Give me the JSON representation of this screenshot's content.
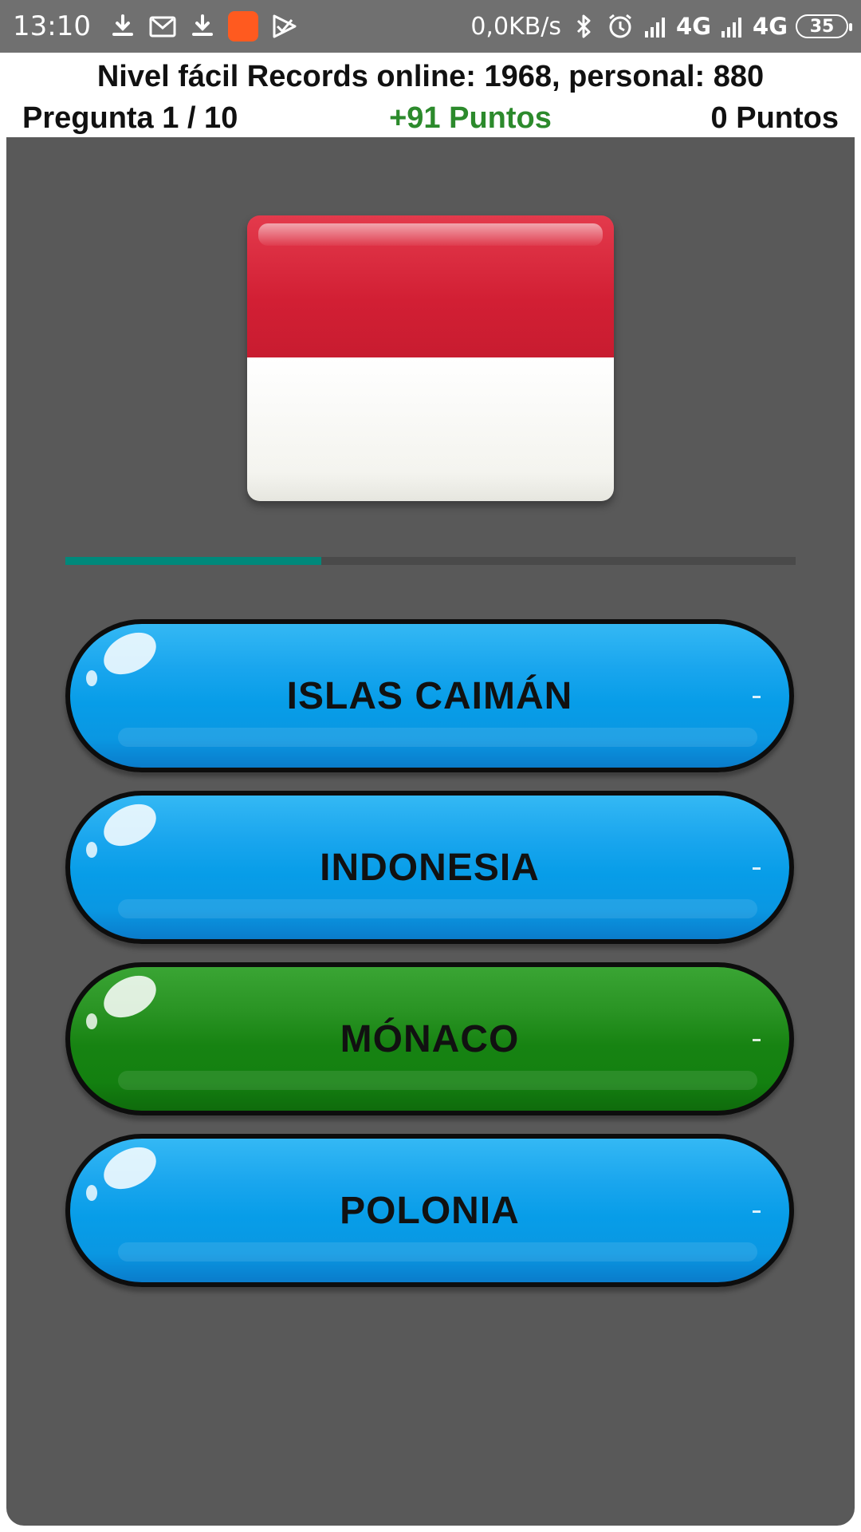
{
  "status_bar": {
    "time": "13:10",
    "left_icons": [
      "download-icon",
      "gmail-icon",
      "download-icon",
      "app-icon",
      "play-store-icon"
    ],
    "net_speed": "0,0KB/s",
    "right_icons": [
      "bluetooth-icon",
      "alarm-icon",
      "signal-icon",
      "signal-icon"
    ],
    "network_1": "4G",
    "network_2": "4G",
    "battery": "35"
  },
  "header": {
    "records": "Nivel fácil Records online: 1968, personal: 880",
    "question": "Pregunta 1 / 10",
    "bonus": "+91 Puntos",
    "score": "0 Puntos",
    "bonus_color": "#2c8a2c"
  },
  "game": {
    "flag": {
      "colors": [
        "#d21f34",
        "#ffffff"
      ]
    },
    "timer_progress": 0.35,
    "timer_color": "#00897b",
    "answers": [
      {
        "label": "ISLAS CAIMÁN",
        "style": "blue"
      },
      {
        "label": "INDONESIA",
        "style": "blue"
      },
      {
        "label": "MÓNACO",
        "style": "green"
      },
      {
        "label": "POLONIA",
        "style": "blue"
      }
    ]
  }
}
